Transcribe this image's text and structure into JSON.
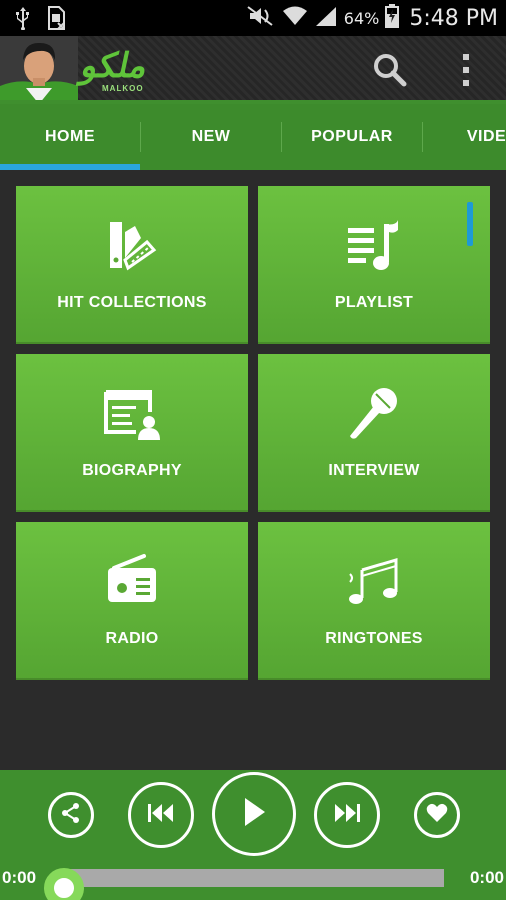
{
  "status_bar": {
    "battery": "64%",
    "time": "5:48 PM",
    "icons": [
      "usb-icon",
      "sim-card-icon",
      "mute-icon",
      "wifi-icon",
      "signal-icon",
      "battery-charging-icon"
    ]
  },
  "app_bar": {
    "logo_text": "ملکو",
    "logo_subtext": "MALKOO",
    "icons": [
      "avatar",
      "search-icon",
      "overflow-menu-icon"
    ]
  },
  "tabs": [
    {
      "label": "HOME",
      "selected": true
    },
    {
      "label": "NEW",
      "selected": false
    },
    {
      "label": "POPULAR",
      "selected": false
    },
    {
      "label": "VIDEO",
      "selected": false
    }
  ],
  "tiles": [
    {
      "label": "HIT COLLECTIONS",
      "icon": "color-swatch-icon"
    },
    {
      "label": "PLAYLIST",
      "icon": "playlist-icon"
    },
    {
      "label": "BIOGRAPHY",
      "icon": "profile-card-icon"
    },
    {
      "label": "INTERVIEW",
      "icon": "microphone-icon"
    },
    {
      "label": "RADIO",
      "icon": "radio-icon"
    },
    {
      "label": "RINGTONES",
      "icon": "music-notes-icon"
    }
  ],
  "player": {
    "buttons": [
      "share-icon",
      "previous-icon",
      "play-icon",
      "next-icon",
      "favorite-icon"
    ],
    "elapsed": "0:00",
    "duration": "0:00",
    "progress": 0
  },
  "colors": {
    "accent_green": "#5fb43a",
    "bar_green": "#3f8f2e",
    "tab_indicator": "#2aa6de",
    "background": "#2b2b2b"
  }
}
